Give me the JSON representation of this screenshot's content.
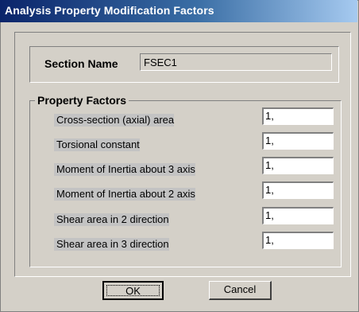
{
  "window": {
    "title": "Analysis Property Modification Factors"
  },
  "section": {
    "label": "Section Name",
    "value": "FSEC1"
  },
  "property_factors": {
    "legend": "Property Factors",
    "items": [
      {
        "label": "Cross-section (axial) area",
        "value": "1,"
      },
      {
        "label": "Torsional constant",
        "value": "1,"
      },
      {
        "label": "Moment of Inertia about 3 axis",
        "value": "1,"
      },
      {
        "label": "Moment of Inertia about 2 axis",
        "value": "1,"
      },
      {
        "label": "Shear area in 2 direction",
        "value": "1,"
      },
      {
        "label": "Shear area in 3 direction",
        "value": "1,"
      }
    ]
  },
  "buttons": {
    "ok": "OK",
    "cancel": "Cancel"
  },
  "colors": {
    "dialog_face": "#d4d0c8",
    "title_start": "#0a246a",
    "title_end": "#a6caf0"
  }
}
